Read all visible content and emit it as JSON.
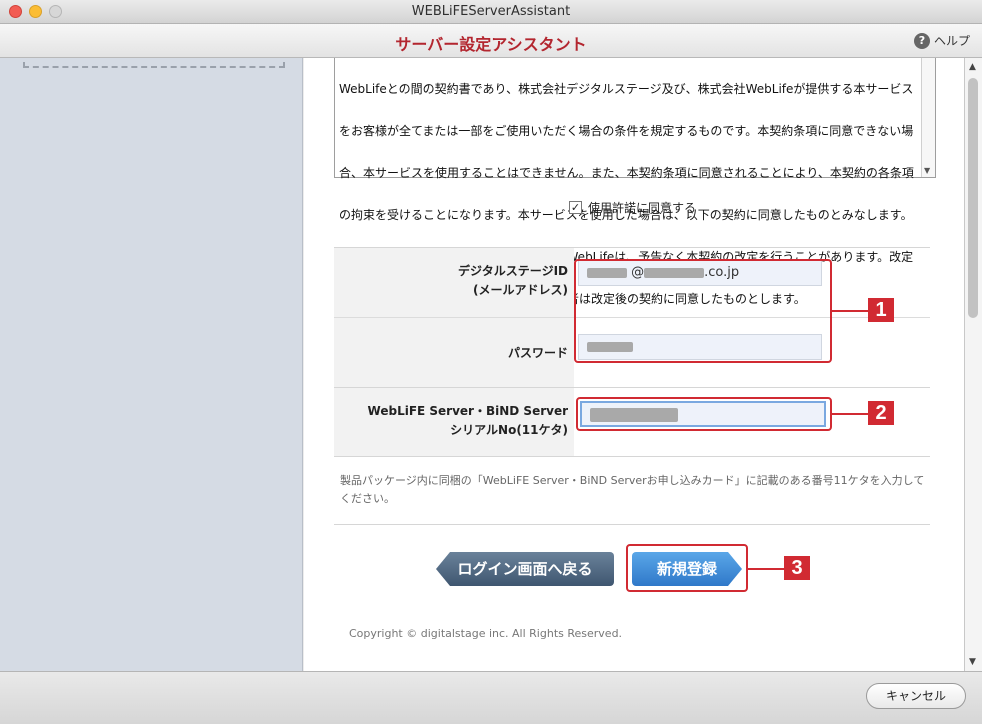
{
  "window": {
    "title": "WEBLiFEServerAssistant"
  },
  "header": {
    "title": "サーバー設定アシスタント",
    "help_label": "ヘルプ"
  },
  "terms": {
    "lines": [
      "WebLifeとの間の契約書であり、株式会社デジタルステージ及び、株式会社WebLifeが提供する本サービス",
      "をお客様が全てまたは一部をご使用いただく場合の条件を規定するものです。本契約条項に同意できない場",
      "合、本サービスを使用することはできません。また、本契約条項に同意されることにより、本契約の各条項",
      "の拘束を受けることになります。本サービスを使用した場合は、以下の契約に同意したものとみなします。",
      "株式会社デジタルステージ及び、株式会社WebLifeは、予告なく本契約の改定を行うことがあります。改定",
      "以降に本サービスの使用をした場合、使用者は改定後の契約に同意したものとします。"
    ]
  },
  "agree": {
    "label": "使用許諾に同意する",
    "checked": true
  },
  "form": {
    "digital_id_label_1": "デジタルステージID",
    "digital_id_label_2": "(メールアドレス)",
    "email_domain": "@",
    "email_suffix": ".co.jp",
    "password_label": "パスワード",
    "serial_label_1": "WebLiFE Server・BiND Server",
    "serial_label_2": "シリアルNo(11ケタ)"
  },
  "help_note": "製品パッケージ内に同梱の「WebLiFE Server・BiND Serverお申し込みカード」に記載のある番号11ケタを入力してください。",
  "buttons": {
    "back": "ログイン画面へ戻る",
    "register": "新規登録",
    "cancel": "キャンセル"
  },
  "callouts": [
    "1",
    "2",
    "3"
  ],
  "copyright": "Copyright © digitalstage inc. All Rights Reserved.",
  "colors": {
    "accent_red": "#d12a32",
    "title_red": "#b3262f",
    "primary_blue": "#2f78c9"
  }
}
